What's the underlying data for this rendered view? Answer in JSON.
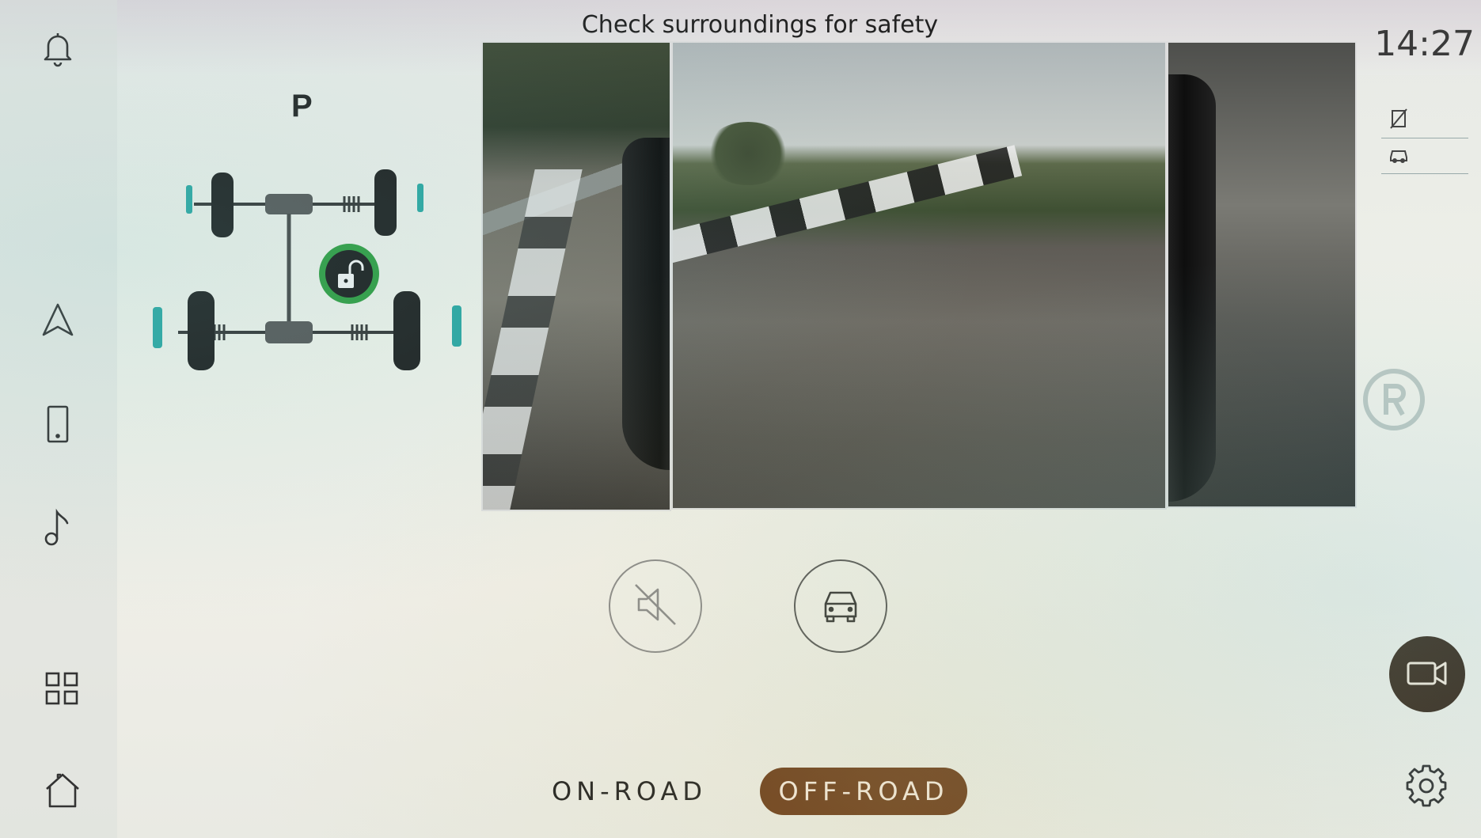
{
  "status": {
    "banner": "Check surroundings for safety",
    "clock": "14:27",
    "gear": "P"
  },
  "sidebar": {
    "items": [
      {
        "id": "notifications",
        "icon": "bell-icon"
      },
      {
        "id": "navigation",
        "icon": "navigation-arrow-icon"
      },
      {
        "id": "phone",
        "icon": "phone-icon"
      },
      {
        "id": "media",
        "icon": "music-note-icon"
      },
      {
        "id": "apps",
        "icon": "grid-icon"
      },
      {
        "id": "home",
        "icon": "home-icon"
      }
    ]
  },
  "drivetrain": {
    "lock_state_icon": "unlocked-padlock-icon",
    "lock_badge_color": "#2e9b3e"
  },
  "right_panel": {
    "icons": [
      "no-parking-sensor-icon",
      "car-side-icon"
    ],
    "watermark_icon": "registered-icon"
  },
  "cameras": {
    "views": [
      {
        "id": "left-camera-view"
      },
      {
        "id": "front-camera-view"
      },
      {
        "id": "right-camera-view"
      }
    ]
  },
  "controls": {
    "mute_icon": "speaker-muted-icon",
    "view_icon": "car-front-view-icon",
    "camera_icon": "camera-icon",
    "settings_icon": "gear-icon"
  },
  "modes": {
    "on_road_label": "ON-ROAD",
    "off_road_label": "OFF-ROAD",
    "selected": "OFF-ROAD",
    "accent_color": "#6b3d1c"
  }
}
